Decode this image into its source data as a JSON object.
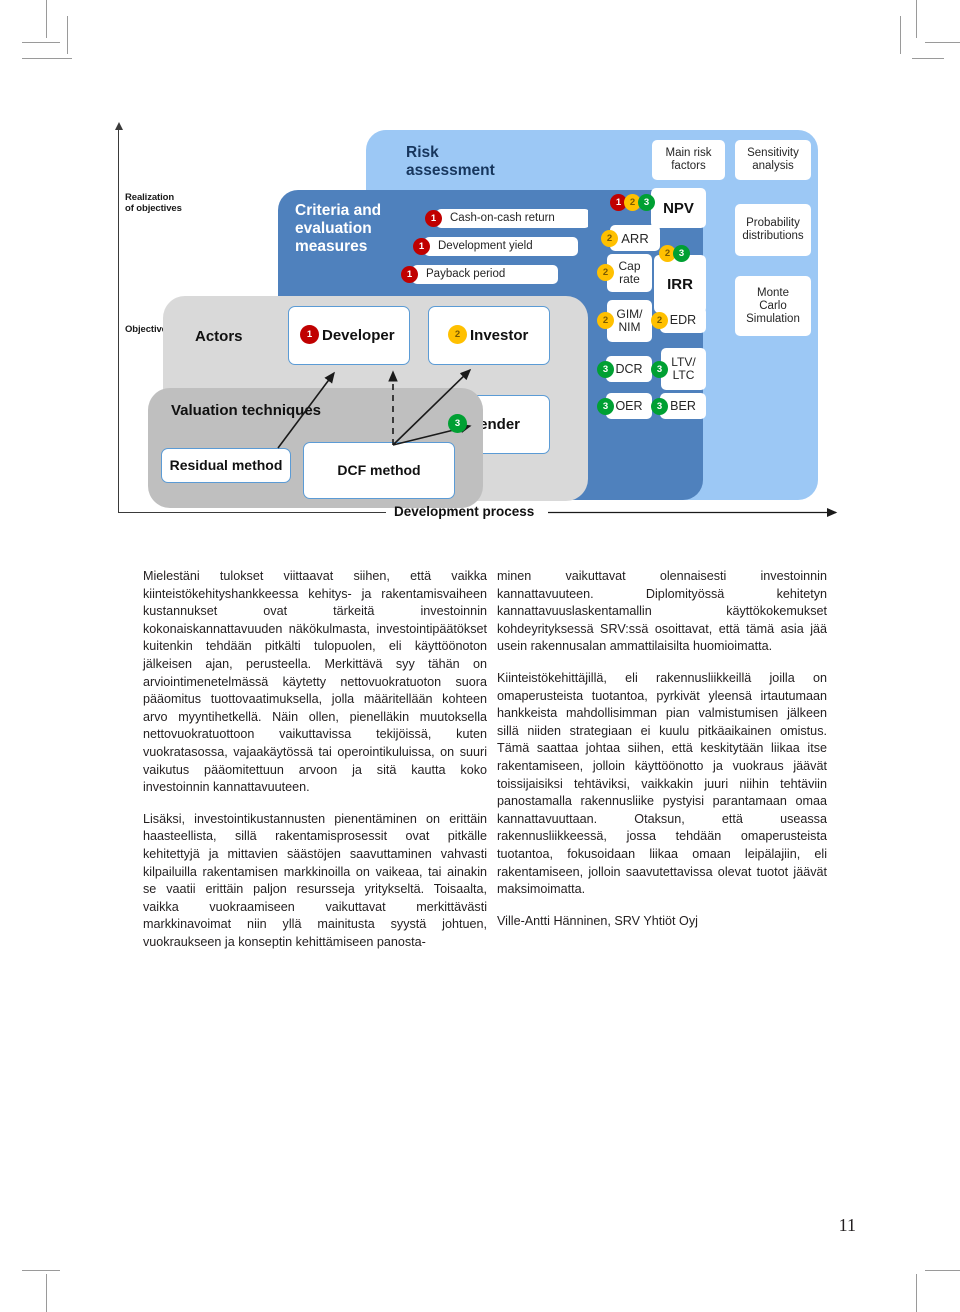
{
  "page": {
    "folio": "11"
  },
  "diagram": {
    "axis": {
      "y_top_label": "Realization\nof objectives",
      "y_top_label_line1": "Realization",
      "y_top_label_line2": "of objectives",
      "y_bottom_label": "Objectives",
      "x_label": "Development process"
    },
    "panels": {
      "risk_title_line1": "Risk",
      "risk_title_line2": "assessment",
      "criteria_title_line1": "Criteria and",
      "criteria_title_line2": "evaluation",
      "criteria_title_line3": "measures",
      "actors_title": "Actors",
      "valuation_title": "Valuation techniques"
    },
    "criteria_items": [
      {
        "badges": [
          "1"
        ],
        "label": "Cash-on-cash return"
      },
      {
        "badges": [
          "1"
        ],
        "label": "Development yield"
      },
      {
        "badges": [
          "1"
        ],
        "label": "Payback period"
      }
    ],
    "measures_items": [
      {
        "badges": [
          "1",
          "2",
          "3"
        ],
        "label": "NPV"
      },
      {
        "badges": [
          "2"
        ],
        "label": "ARR"
      },
      {
        "badges": [
          "2"
        ],
        "label": "Cap rate",
        "line1": "Cap",
        "line2": "rate"
      },
      {
        "badges": [
          "2"
        ],
        "label": "GIM/ NIM",
        "line1": "GIM/",
        "line2": "NIM"
      },
      {
        "badges": [
          "2",
          "3"
        ],
        "label": "IRR"
      },
      {
        "badges": [
          "2"
        ],
        "label": "EDR"
      },
      {
        "badges": [
          "3"
        ],
        "label": "DCR"
      },
      {
        "badges": [
          "3"
        ],
        "label": "LTV/ LTC",
        "line1": "LTV/",
        "line2": "LTC"
      },
      {
        "badges": [
          "3"
        ],
        "label": "OER"
      },
      {
        "badges": [
          "3"
        ],
        "label": "BER"
      }
    ],
    "risk_items": [
      {
        "line1": "Main risk",
        "line2": "factors"
      },
      {
        "line1": "Sensitivity",
        "line2": "analysis"
      },
      {
        "line1": "Probability",
        "line2": "distributions"
      },
      {
        "line1": "Monte",
        "line2": "Carlo",
        "line3": "Simulation"
      }
    ],
    "actors": [
      {
        "badge": "1",
        "label": "Developer"
      },
      {
        "badge": "2",
        "label": "Investor"
      },
      {
        "badge": "3",
        "label": "Lender"
      }
    ],
    "valuation_methods": [
      {
        "label": "Residual method"
      },
      {
        "label": "DCF method"
      }
    ],
    "colors": {
      "light_blue": "#9cc8f5",
      "mid_blue": "#4f81bd",
      "light_gray": "#d9d9d9",
      "mid_gray": "#bfbfbf",
      "badge_red": "#c00000",
      "badge_yellow": "#ffc000",
      "badge_green": "#00a033",
      "box_border": "#5b9bd5"
    }
  },
  "article": {
    "left_column": [
      "Mielestäni tulokset viittaavat siihen, että vaikka kiinteistökehityshankkeessa kehitys- ja rakentamisvaiheen kustannukset ovat tärkeitä investoinnin kokonaiskannattavuuden näkökulmasta, investointipäätökset kuitenkin tehdään pitkälti tulopuolen, eli käyttöönoton jälkeisen ajan, perusteella. Merkittävä syy tähän on arviointimenetelmässä käytetty nettovuokratuoton suora pääomitus tuottovaatimuksella, jolla määritellään kohteen arvo myyntihetkellä. Näin ollen, pienelläkin muutoksella nettovuokratuottoon vaikuttavissa tekijöissä, kuten vuokratasossa, vajaakäytössä tai operointikuluissa, on suuri vaikutus pääomitettuun arvoon ja sitä kautta koko investoinnin kannattavuuteen.",
      "Lisäksi, investointikustannusten pienentäminen on erittäin haasteellista, sillä rakentamisprosessit ovat pitkälle kehitettyjä ja mittavien säästöjen saavuttaminen vahvasti kilpailuilla rakentamisen markkinoilla on vaikeaa, tai ainakin se vaatii erittäin paljon resursseja yritykseltä. Toisaalta, vaikka vuokraamiseen vaikuttavat merkittävästi markkinavoimat niin yllä mainitusta syystä johtuen, vuokraukseen ja konseptin kehittämiseen panosta-"
    ],
    "right_column": [
      "minen vaikuttavat olennaisesti investoinnin kannattavuuteen. Diplomityössä kehitetyn kannattavuuslaskentamallin käyttökokemukset kohdeyrityksessä SRV:ssä osoittavat, että tämä asia jää usein rakennusalan ammattilaisilta huomioimatta.",
      "Kiinteistökehittäjillä, eli rakennusliikkeillä joilla on omaperusteista tuotantoa, pyrkivät yleensä irtautumaan hankkeista mahdollisimman pian valmistumisen jälkeen sillä niiden strategiaan ei kuulu pitkäaikainen omistus. Tämä saattaa johtaa siihen, että keskitytään liikaa itse rakentamiseen, jolloin käyttöönotto ja vuokraus jäävät toissijaisiksi tehtäviksi, vaikkakin juuri niihin tehtäviin panostamalla rakennusliike pystyisi parantamaan omaa kannattavuuttaan. Otaksun, että useassa rakennusliikkeessä, jossa tehdään omaperusteista tuotantoa, fokusoidaan liikaa omaan leipälajiin, eli rakentamiseen, jolloin saavutettavissa olevat tuotot jäävät maksimoimatta."
    ],
    "signature": "Ville-Antti Hänninen, SRV Yhtiöt Oyj"
  }
}
